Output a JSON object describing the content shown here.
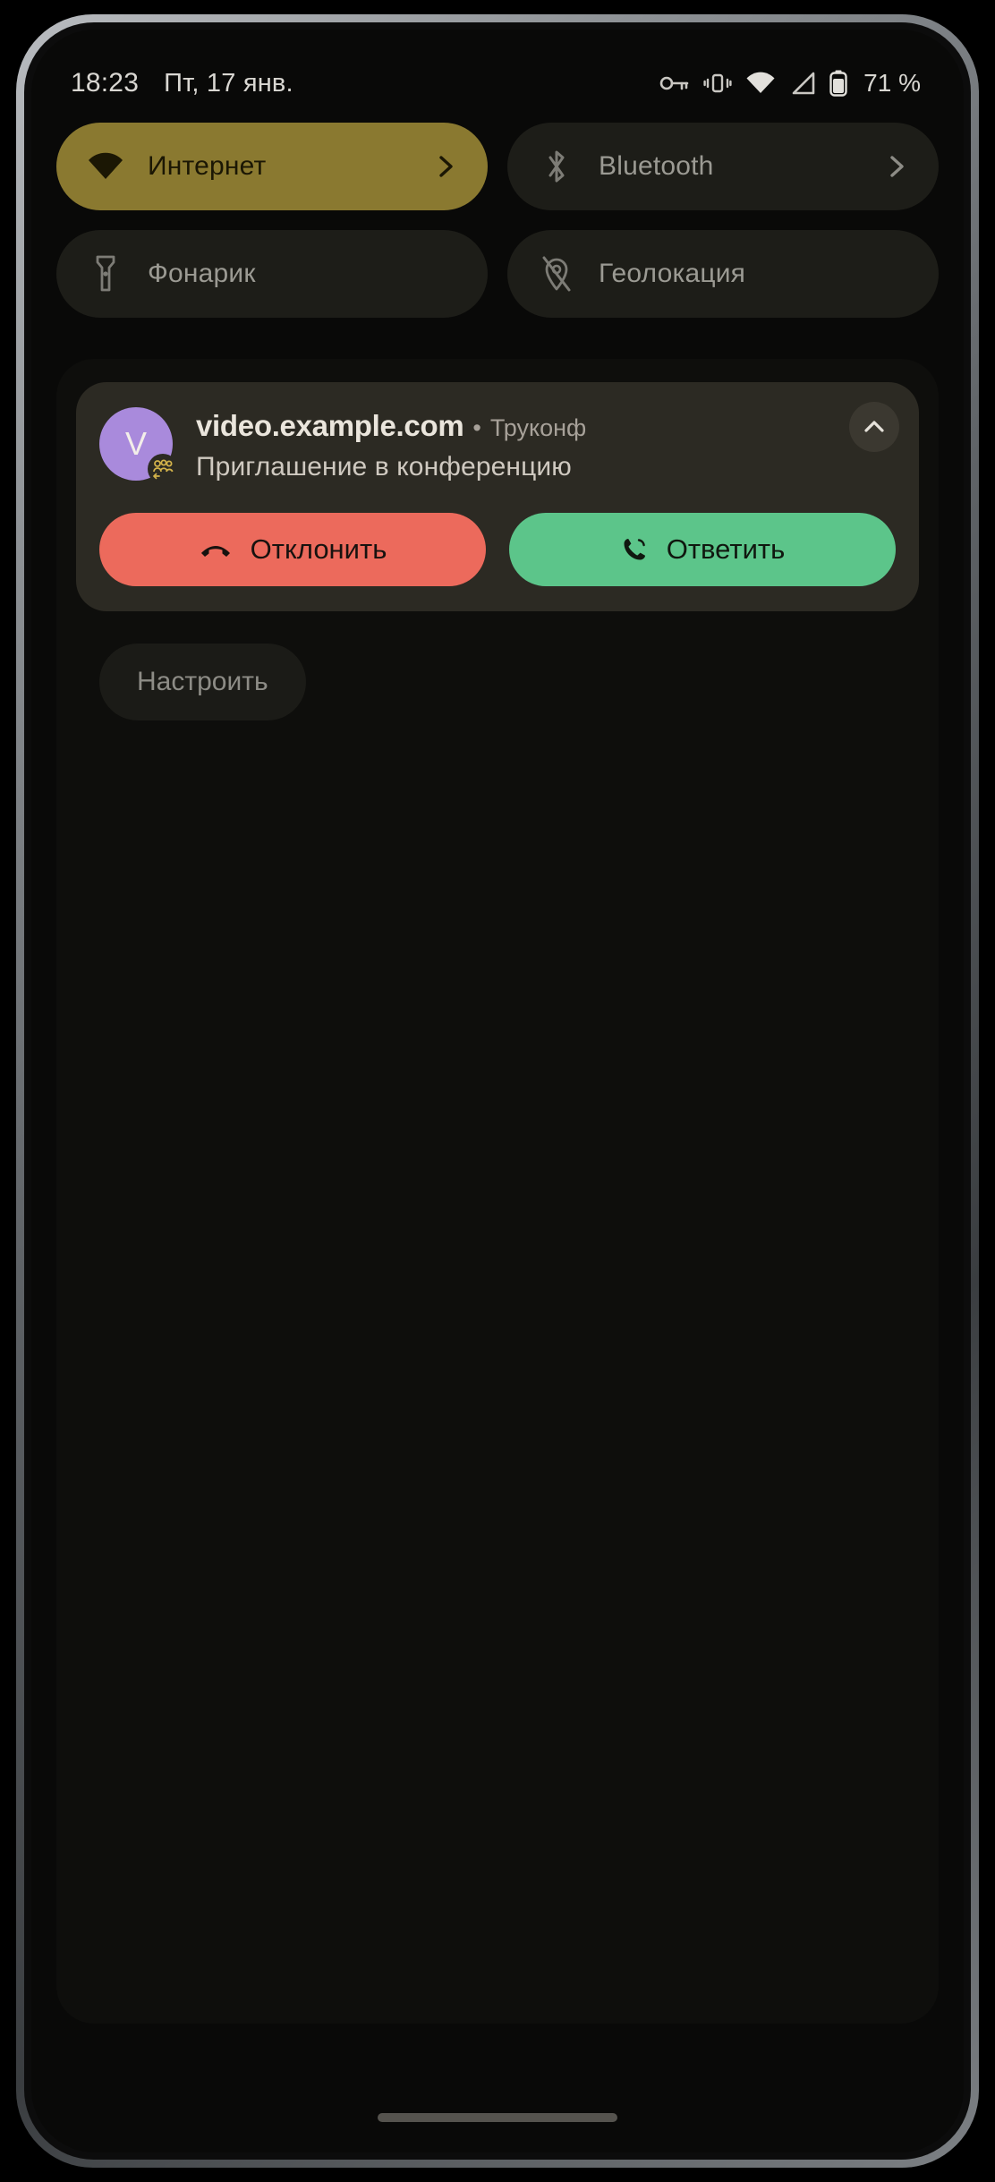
{
  "status_bar": {
    "clock": "18:23",
    "date": "Пт, 17 янв.",
    "icons": [
      "vpn-key-icon",
      "vibrate-icon",
      "wifi-icon",
      "cellular-signal-icon",
      "battery-icon"
    ],
    "battery_text": "71 %"
  },
  "quick_settings": {
    "tiles": [
      {
        "id": "internet",
        "label": "Интернет",
        "icon": "wifi-icon",
        "active": true,
        "has_chevron": true
      },
      {
        "id": "bluetooth",
        "label": "Bluetooth",
        "icon": "bluetooth-icon",
        "active": false,
        "has_chevron": true
      },
      {
        "id": "flashlight",
        "label": "Фонарик",
        "icon": "flashlight-icon",
        "active": false,
        "has_chevron": false
      },
      {
        "id": "location",
        "label": "Геолокация",
        "icon": "location-off-icon",
        "active": false,
        "has_chevron": false
      }
    ]
  },
  "notification": {
    "avatar_initial": "V",
    "avatar_badge_icon": "group-call-icon",
    "domain": "video.example.com",
    "separator": "•",
    "app_name": "Труконф",
    "subtitle": "Приглашение в конференцию",
    "expand_icon": "chevron-up-icon",
    "actions": [
      {
        "id": "decline",
        "label": "Отклонить",
        "icon": "call-end-icon",
        "color": "#ec6a5c"
      },
      {
        "id": "answer",
        "label": "Ответить",
        "icon": "call-icon",
        "color": "#5cc58a"
      }
    ]
  },
  "footer": {
    "settings_label": "Настроить"
  },
  "colors": {
    "tile_active": "#8a7930",
    "tile_inactive": "#1d1d18",
    "card_bg": "#2c2a23",
    "shade_bg": "#0e0e0c",
    "avatar": "#a98adc",
    "decline": "#ec6a5c",
    "answer": "#5cc58a",
    "badge_gold": "#d2b24a"
  }
}
